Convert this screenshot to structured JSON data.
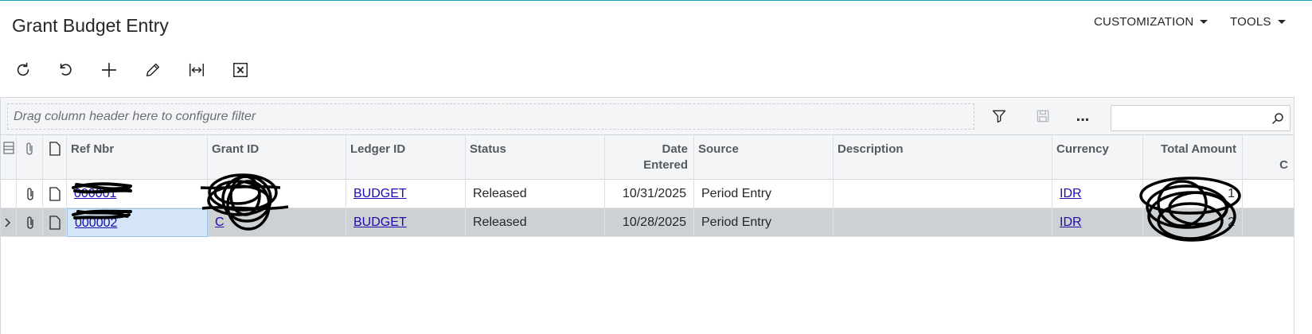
{
  "page": {
    "title": "Grant Budget Entry"
  },
  "top_menu": [
    {
      "label": "CUSTOMIZATION"
    },
    {
      "label": "TOOLS"
    }
  ],
  "toolbar": {
    "buttons": [
      {
        "icon": "refresh-icon"
      },
      {
        "icon": "undo-icon"
      },
      {
        "icon": "add-icon"
      },
      {
        "icon": "edit-icon"
      },
      {
        "icon": "fit-columns-icon"
      },
      {
        "icon": "export-excel-icon"
      }
    ]
  },
  "filter": {
    "placeholder": "Drag column header here to configure filter",
    "search_placeholder": "",
    "more_label": "..."
  },
  "columns": {
    "ref_nbr": "Ref Nbr",
    "grant_id": "Grant ID",
    "ledger_id": "Ledger ID",
    "status": "Status",
    "date_entered": "Date Entered",
    "source": "Source",
    "description": "Description",
    "currency": "Currency",
    "total_amount": "Total Amount",
    "next": "C"
  },
  "rows": [
    {
      "ref_nbr": "000001",
      "grant_id": "",
      "ledger_id": "BUDGET",
      "status": "Released",
      "date_entered": "10/31/2025",
      "source": "Period Entry",
      "description": "",
      "currency": "IDR",
      "total_amount": "1"
    },
    {
      "ref_nbr": "000002",
      "grant_id": "C",
      "ledger_id": "BUDGET",
      "status": "Released",
      "date_entered": "10/28/2025",
      "source": "Period Entry",
      "description": "",
      "currency": "IDR",
      "total_amount": "2"
    }
  ],
  "colors": {
    "accent": "#1b9fb0",
    "link": "#1a0dab",
    "selected_row": "#cdd1d4",
    "active_cell": "#d4e6f7",
    "header_bg": "#f4f5f7"
  }
}
